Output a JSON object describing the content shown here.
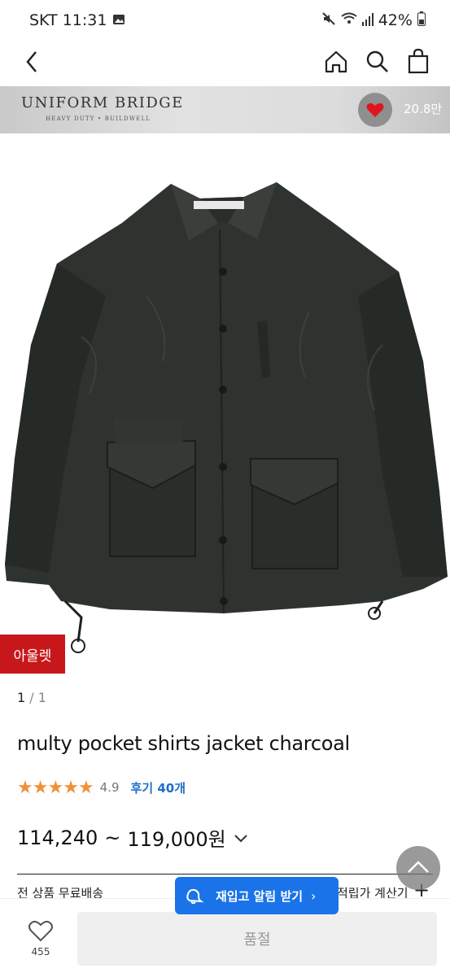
{
  "status_bar": {
    "carrier_time": "SKT 11:31",
    "battery": "42%"
  },
  "nav": {
    "back_icon": "chevron-left-icon",
    "home_icon": "home-icon",
    "search_icon": "search-icon",
    "cart_icon": "bag-icon"
  },
  "brand": {
    "name": "UNIFORM BRIDGE",
    "tagline": "HEAVY DUTY • BUILDWELL",
    "favorite_count": "20.8만"
  },
  "product": {
    "badge": "아울렛",
    "image_index": "1",
    "image_total": "/ 1",
    "title": "multy pocket shirts jacket charcoal",
    "rating_value": "4.9",
    "rating_stars": 5,
    "review_link": "후기 40개",
    "price_min": "114,240",
    "price_sep": "~",
    "price_max": "119,000원"
  },
  "shipping": {
    "left_text": "전 상품 무료배송",
    "right_text": "적립가 계산기",
    "plus": "+"
  },
  "toast": {
    "label": "재입고 알림 받기",
    "arrow": "›"
  },
  "bottom_bar": {
    "like_count": "455",
    "buy_label": "품절"
  },
  "colors": {
    "accent_blue": "#1a73e8",
    "outlet_red": "#c8171b",
    "star_orange": "#f0913a",
    "heart_red": "#e0141e"
  }
}
